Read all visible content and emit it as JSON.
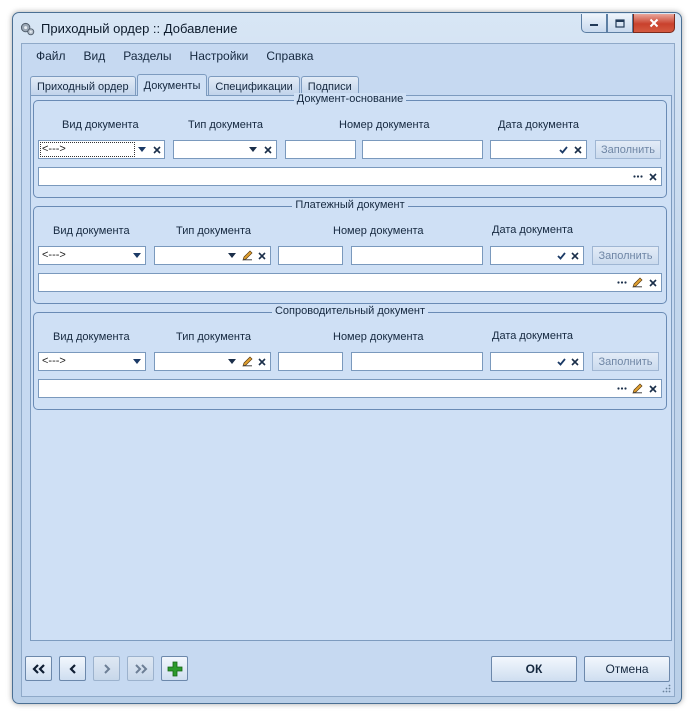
{
  "window": {
    "title": "Приходный ордер :: Добавление"
  },
  "menu": [
    "Файл",
    "Вид",
    "Разделы",
    "Настройки",
    "Справка"
  ],
  "tabs": [
    {
      "label": "Приходный ордер",
      "active": false
    },
    {
      "label": "Документы",
      "active": true
    },
    {
      "label": "Спецификации",
      "active": false
    },
    {
      "label": "Подписи",
      "active": false
    }
  ],
  "labels": {
    "doc_kind": "Вид документа",
    "doc_type": "Тип документа",
    "doc_number": "Номер документа",
    "doc_date": "Дата документа",
    "fill_button": "Заполнить"
  },
  "groups": [
    {
      "title": "Документ-основание",
      "kind_value": "<--->"
    },
    {
      "title": "Платежный документ",
      "kind_value": "<--->"
    },
    {
      "title": "Сопроводительный документ",
      "kind_value": "<--->"
    }
  ],
  "buttons": {
    "ok": "ОК",
    "cancel": "Отмена"
  },
  "colors": {
    "window_bg": "#c6d9f1",
    "panel_bg": "#cfe0f5",
    "border": "#7d9bbf",
    "close_red": "#c9412d",
    "add_green": "#2c9a2c"
  }
}
